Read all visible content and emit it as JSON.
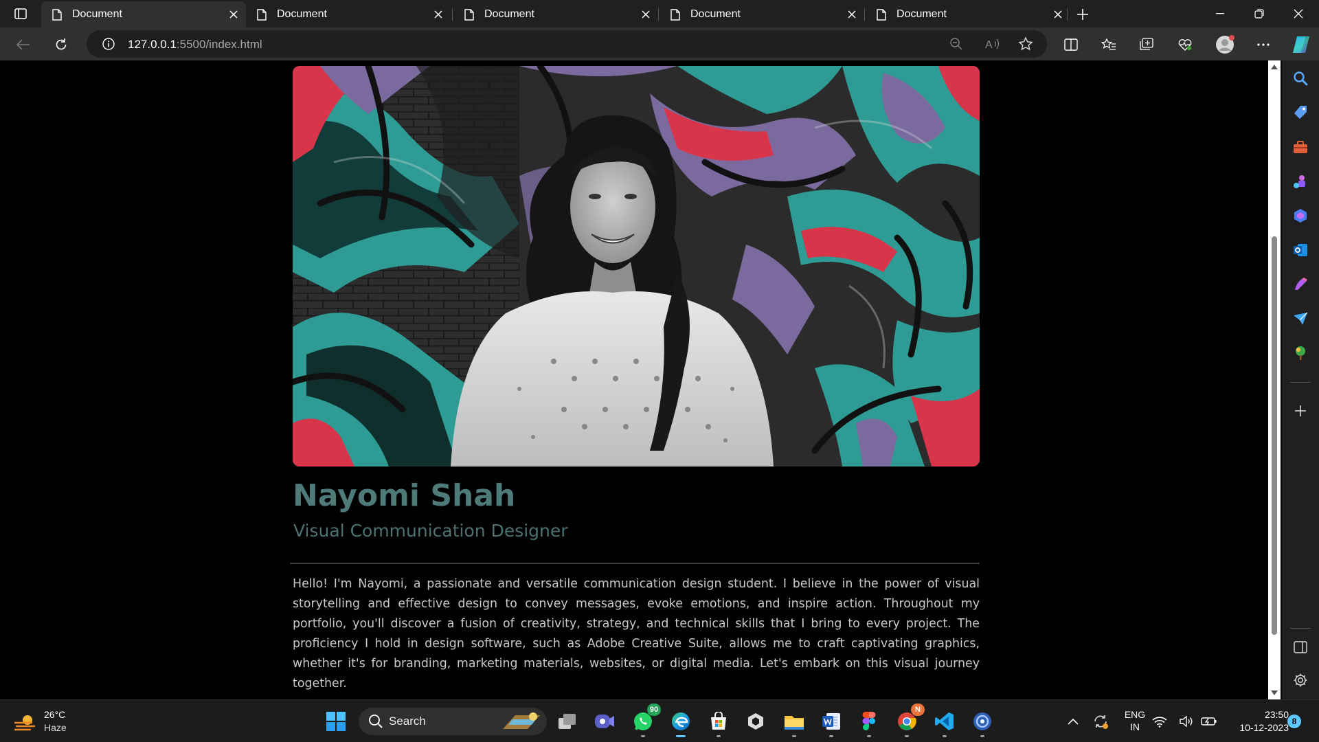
{
  "browser": {
    "tabs": [
      {
        "title": "Document",
        "active": true
      },
      {
        "title": "Document",
        "active": false
      },
      {
        "title": "Document",
        "active": false
      },
      {
        "title": "Document",
        "active": false
      },
      {
        "title": "Document",
        "active": false
      }
    ],
    "address": {
      "host": "127.0.0.1",
      "rest": ":5500/index.html"
    },
    "icons": [
      "tab-actions-icon",
      "new-tab-icon",
      "minimize-icon",
      "restore-icon",
      "close-icon",
      "back-icon",
      "refresh-icon",
      "site-info-icon",
      "zoom-out-icon",
      "read-aloud-icon",
      "favorite-star-icon",
      "split-screen-icon",
      "favorites-icon",
      "collections-icon",
      "browser-essentials-icon",
      "profile-avatar",
      "more-menu-icon",
      "copilot-icon"
    ]
  },
  "sidebar": {
    "icons": [
      "search-icon",
      "shopping-icon",
      "tools-icon",
      "games-icon",
      "microsoft-365-icon",
      "outlook-icon",
      "designer-icon",
      "drop-icon",
      "tree-icon",
      "add-icon",
      "hide-sidebar-icon",
      "settings-icon"
    ]
  },
  "page": {
    "name": "Nayomi Shah",
    "role": "Visual Communication Designer",
    "bio": "Hello! I'm Nayomi, a passionate and versatile communication design student. I believe in the power of visual storytelling and effective design to convey messages, evoke emotions, and inspire action. Throughout my portfolio, you'll discover a fusion of creativity, strategy, and technical skills that I bring to every project. The proficiency I hold in design software, such as Adobe Creative Suite, allows me to craft captivating graphics, whether it's for branding, marketing materials, websites, or digital media. Let's embark on this visual journey together.",
    "colors": {
      "name": "#4e7a7a",
      "role": "#4d7171",
      "text": "#c9c9c9",
      "graffiti_teal": "#2e9c94",
      "graffiti_purple": "#7a6a9e",
      "graffiti_red": "#d8344a"
    }
  },
  "taskbar": {
    "weather": {
      "temp": "26°C",
      "condition": "Haze"
    },
    "search_label": "Search",
    "apps": [
      {
        "name": "start-icon"
      },
      {
        "name": "task-view-icon"
      },
      {
        "name": "meet-icon"
      },
      {
        "name": "whatsapp-icon",
        "badge": "90"
      },
      {
        "name": "edge-icon",
        "active": true
      },
      {
        "name": "store-icon"
      },
      {
        "name": "unity-icon"
      },
      {
        "name": "file-explorer-icon"
      },
      {
        "name": "word-icon"
      },
      {
        "name": "figma-icon"
      },
      {
        "name": "chrome-icon",
        "badge": "N"
      },
      {
        "name": "vscode-icon"
      },
      {
        "name": "app-icon"
      }
    ],
    "tray": {
      "lang_top": "ENG",
      "lang_bottom": "IN",
      "time": "23:50",
      "date": "10-12-2023",
      "notifications": "8"
    }
  }
}
